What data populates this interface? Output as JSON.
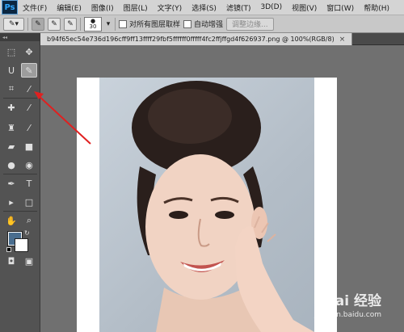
{
  "app": {
    "logo_text": "Ps",
    "menu": [
      "文件(F)",
      "编辑(E)",
      "图像(I)",
      "图层(L)",
      "文字(Y)",
      "选择(S)",
      "滤镜(T)",
      "3D(D)",
      "视图(V)",
      "窗口(W)",
      "帮助(H)"
    ]
  },
  "options_bar": {
    "brush_size": "30",
    "sample_all_layers_label": "对所有图层取样",
    "auto_enhance_label": "自动增强",
    "refine_edge_label": "调整边缘..."
  },
  "document": {
    "tab_title": "b94f65ec54e736d196cff9ff13ffff29fbf5ffffff0fffff4fc2ffjffgd4f626937.png @ 100%(RGB/8)",
    "close_symbol": "×"
  },
  "tools": {
    "items": [
      {
        "name": "marquee-tool-icon",
        "glyph": "⬚",
        "active": false
      },
      {
        "name": "move-tool-icon",
        "glyph": "✥",
        "active": false
      },
      {
        "name": "lasso-tool-icon",
        "glyph": "ᑌ",
        "active": false
      },
      {
        "name": "quick-selection-tool-icon",
        "glyph": "✎",
        "active": true
      },
      {
        "name": "crop-tool-icon",
        "glyph": "⌗",
        "active": false
      },
      {
        "name": "eyedropper-tool-icon",
        "glyph": "⁄",
        "active": false
      },
      {
        "name": "healing-brush-tool-icon",
        "glyph": "✚",
        "active": false
      },
      {
        "name": "brush-tool-icon",
        "glyph": "⁄",
        "active": false
      },
      {
        "name": "clone-stamp-tool-icon",
        "glyph": "♜",
        "active": false
      },
      {
        "name": "history-brush-tool-icon",
        "glyph": "⁄",
        "active": false
      },
      {
        "name": "eraser-tool-icon",
        "glyph": "▰",
        "active": false
      },
      {
        "name": "gradient-tool-icon",
        "glyph": "■",
        "active": false
      },
      {
        "name": "blur-tool-icon",
        "glyph": "●",
        "active": false
      },
      {
        "name": "dodge-tool-icon",
        "glyph": "◉",
        "active": false
      },
      {
        "name": "pen-tool-icon",
        "glyph": "✒",
        "active": false
      },
      {
        "name": "type-tool-icon",
        "glyph": "T",
        "active": false
      },
      {
        "name": "path-selection-tool-icon",
        "glyph": "▸",
        "active": false
      },
      {
        "name": "shape-tool-icon",
        "glyph": "□",
        "active": false
      },
      {
        "name": "hand-tool-icon",
        "glyph": "✋",
        "active": false
      },
      {
        "name": "zoom-tool-icon",
        "glyph": "⌕",
        "active": false
      },
      {
        "name": "quick-mask-icon",
        "glyph": "◘",
        "active": false
      },
      {
        "name": "screen-mode-icon",
        "glyph": "▣",
        "active": false
      }
    ]
  },
  "colors": {
    "foreground": "#4a6e8f",
    "background": "#ffffff",
    "annotation_arrow": "#e02020"
  },
  "watermark": {
    "logo": "Bai 经验",
    "url": "jingyan.baidu.com"
  }
}
